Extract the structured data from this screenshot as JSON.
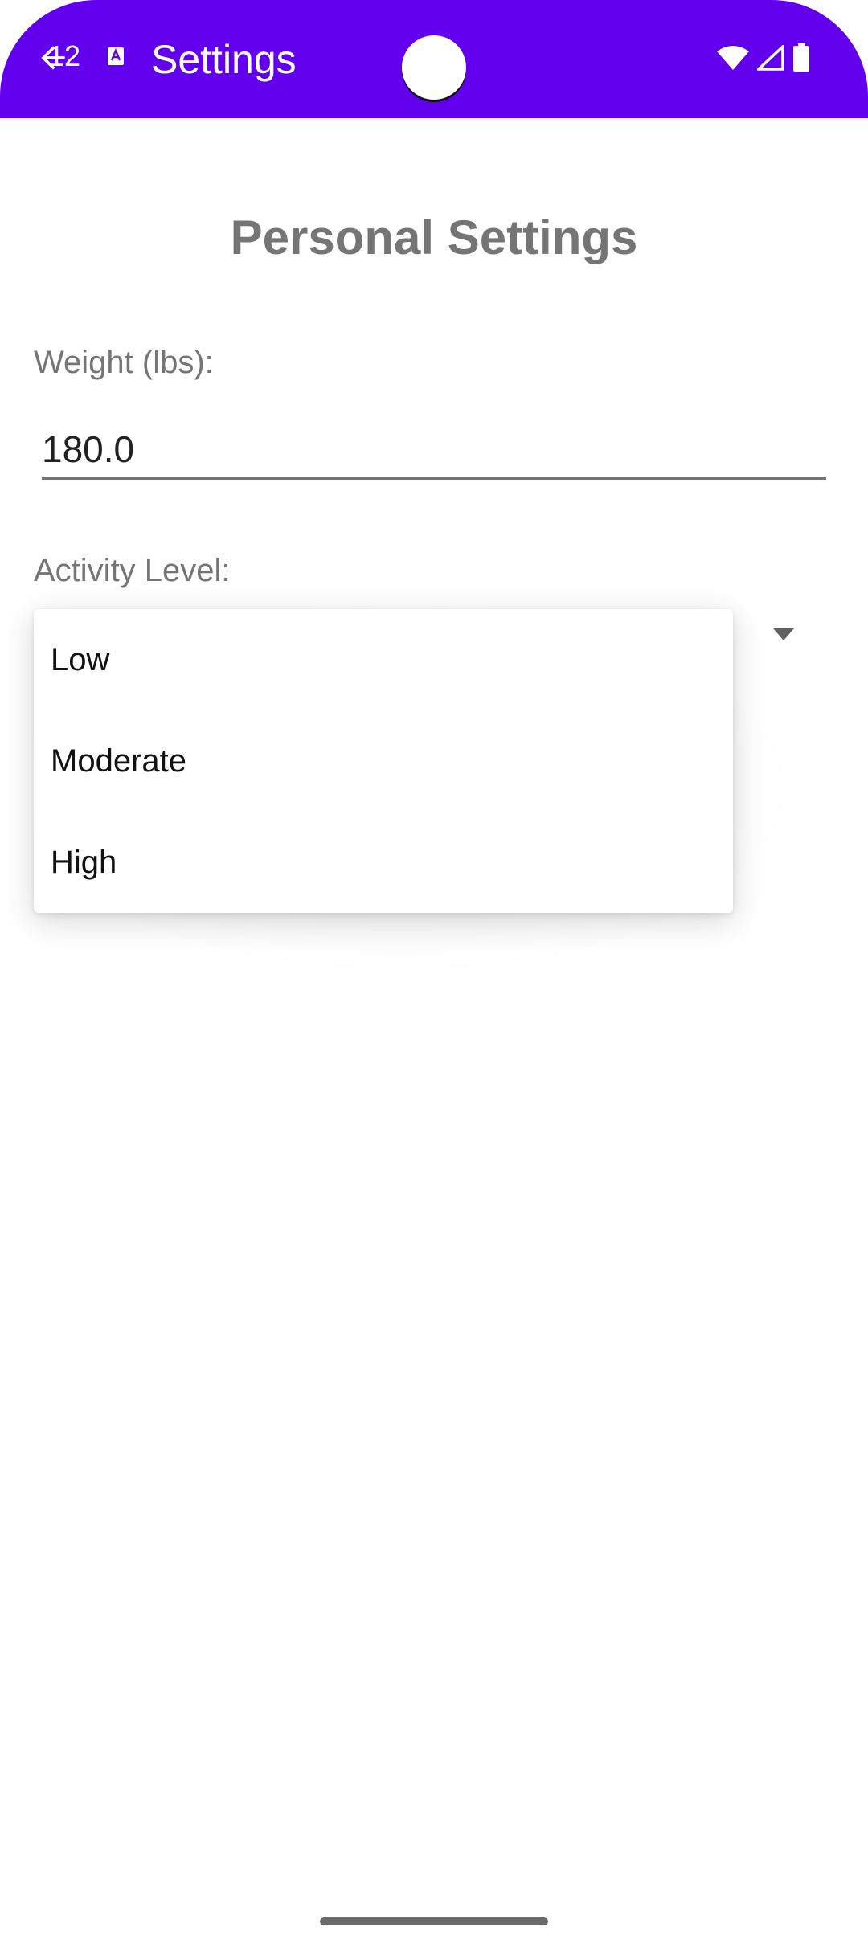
{
  "status_bar": {
    "time": "12",
    "icons": [
      "a-notification-icon",
      "wifi-icon",
      "cellular-signal-icon",
      "battery-icon"
    ]
  },
  "app_bar": {
    "title": "Settings",
    "background_color": "#6200EE"
  },
  "page": {
    "heading": "Personal Settings"
  },
  "weight": {
    "label": "Weight (lbs):",
    "value": "180.0"
  },
  "activity": {
    "label": "Activity Level:",
    "options": [
      "Low",
      "Moderate",
      "High"
    ]
  }
}
